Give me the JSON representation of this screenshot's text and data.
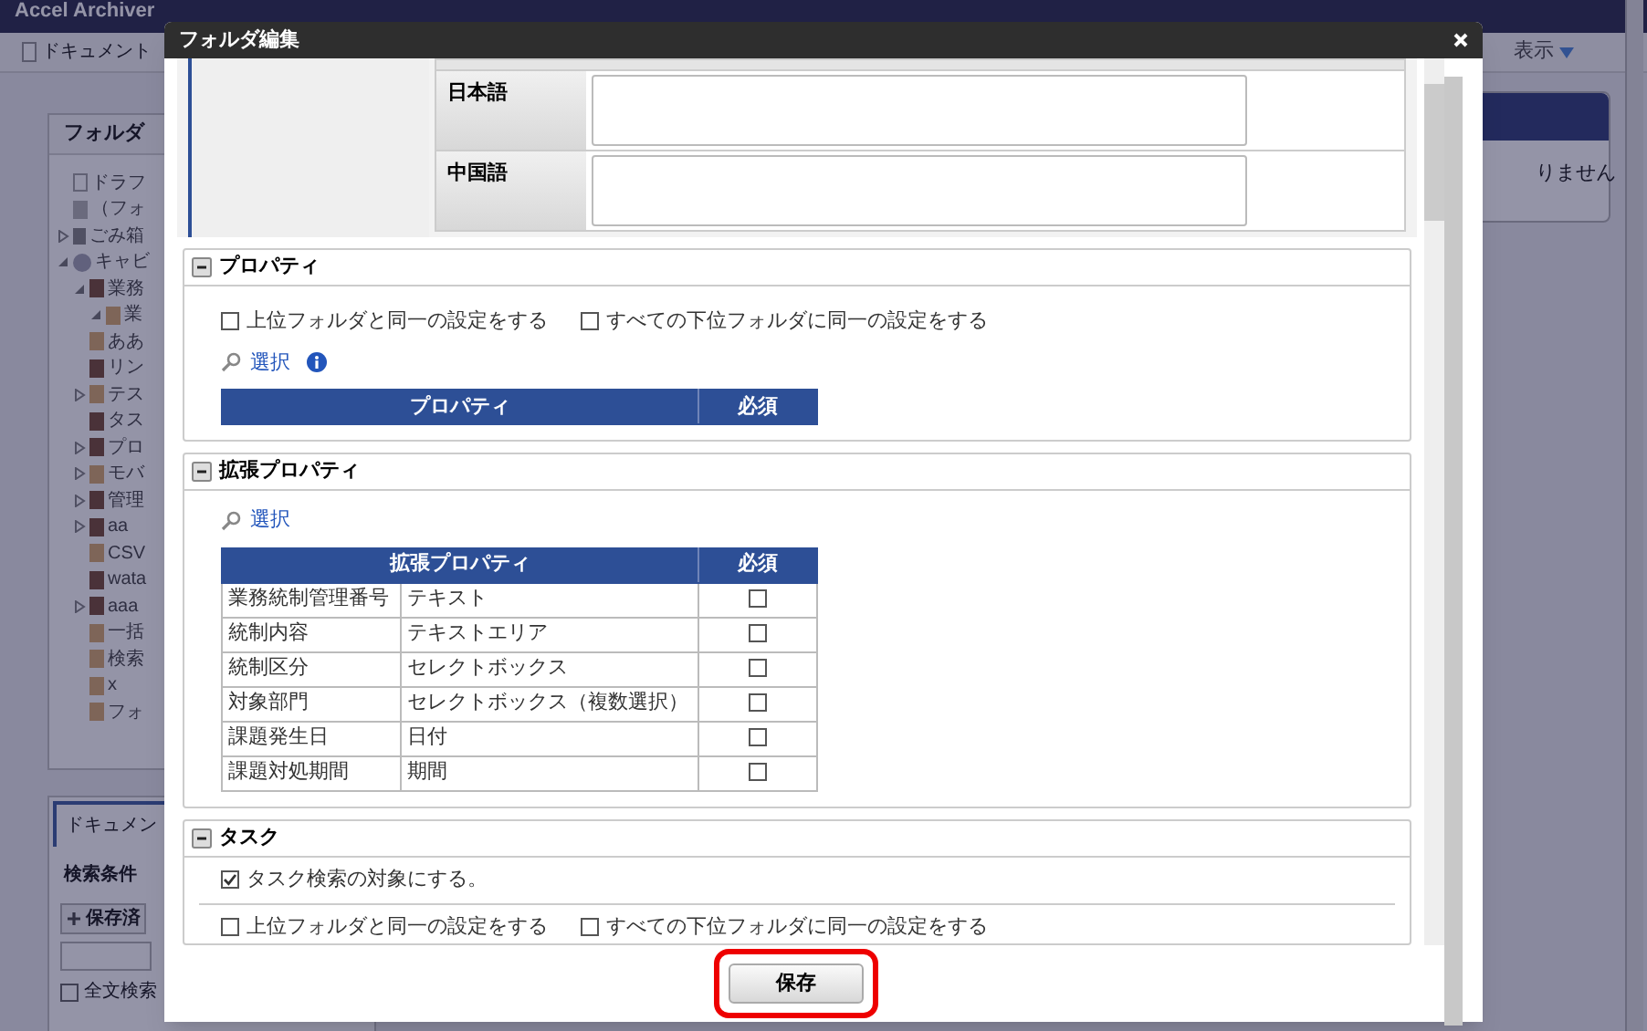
{
  "app": {
    "title": "Accel Archiver",
    "toolbar_button": "ドキュメント",
    "view_menu": "表示",
    "message": "りません",
    "folder_panel": {
      "title": "フォルダ",
      "tree": [
        {
          "label": "ドラフ",
          "kind": "draft"
        },
        {
          "label": "（フォ",
          "kind": "doc"
        },
        {
          "label": "ごみ箱",
          "kind": "trash",
          "expanded": false
        },
        {
          "label": "キャビ",
          "kind": "db",
          "expanded": true,
          "children": [
            {
              "label": "業務",
              "kind": "cabinet",
              "expanded": true,
              "children": [
                {
                  "label": "業",
                  "kind": "folder",
                  "expanded": true
                }
              ]
            },
            {
              "label": "ああ",
              "kind": "folder"
            },
            {
              "label": "リン",
              "kind": "cabinet"
            },
            {
              "label": "テス",
              "kind": "folder",
              "expanded": false
            },
            {
              "label": "タス",
              "kind": "cabinet"
            },
            {
              "label": "プロ",
              "kind": "cabinet",
              "expanded": false
            },
            {
              "label": "モバ",
              "kind": "folder",
              "expanded": false
            },
            {
              "label": "管理",
              "kind": "cabinet",
              "expanded": false
            },
            {
              "label": "aa",
              "kind": "cabinet",
              "expanded": false
            },
            {
              "label": "CSV",
              "kind": "folder"
            },
            {
              "label": "wata",
              "kind": "cabinet"
            },
            {
              "label": "aaa",
              "kind": "cabinet",
              "expanded": false
            },
            {
              "label": "一括",
              "kind": "folder"
            },
            {
              "label": "検索",
              "kind": "folder"
            },
            {
              "label": "x",
              "kind": "folder"
            },
            {
              "label": "フォ",
              "kind": "folder"
            }
          ]
        }
      ]
    },
    "search_panel": {
      "tab": "ドキュメン",
      "conditions_label": "検索条件",
      "saved_button": "保存済",
      "fulltext": {
        "label": "全文検索",
        "checked": false
      }
    }
  },
  "dialog": {
    "title": "フォルダ編集",
    "name_rows": [
      {
        "label": "日本語",
        "value": ""
      },
      {
        "label": "中国語",
        "value": ""
      }
    ],
    "sections": [
      {
        "kind": "property_table",
        "title": "プロパティ",
        "expanded": true,
        "options": [
          {
            "label": "上位フォルダと同一の設定をする",
            "checked": false
          },
          {
            "label": "すべての下位フォルダに同一の設定をする",
            "checked": false
          }
        ],
        "select_link": "選択",
        "info": true,
        "columns": [
          "プロパティ",
          "必須"
        ]
      },
      {
        "kind": "property_table",
        "title": "拡張プロパティ",
        "expanded": true,
        "select_link": "選択",
        "columns": [
          "拡張プロパティ",
          "必須"
        ],
        "rows": [
          {
            "name": "業務統制管理番号",
            "type": "テキスト",
            "required": false
          },
          {
            "name": "統制内容",
            "type": "テキストエリア",
            "required": false
          },
          {
            "name": "統制区分",
            "type": "セレクトボックス",
            "required": false
          },
          {
            "name": "対象部門",
            "type": "セレクトボックス（複数選択）",
            "required": false
          },
          {
            "name": "課題発生日",
            "type": "日付",
            "required": false
          },
          {
            "name": "課題対処期間",
            "type": "期間",
            "required": false
          }
        ]
      },
      {
        "kind": "task",
        "title": "タスク",
        "expanded": true,
        "task_search": {
          "label": "タスク検索の対象にする。",
          "checked": true
        },
        "options": [
          {
            "label": "上位フォルダと同一の設定をする",
            "checked": false
          },
          {
            "label": "すべての下位フォルダに同一の設定をする",
            "checked": false
          }
        ]
      }
    ],
    "save_button": {
      "label": "保存",
      "highlighted": true
    }
  }
}
